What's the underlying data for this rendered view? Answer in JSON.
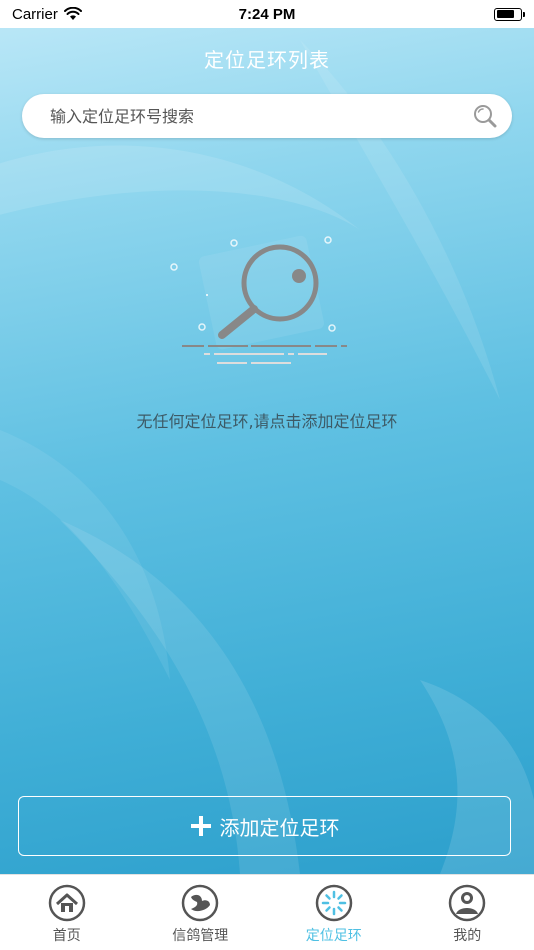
{
  "status_bar": {
    "carrier": "Carrier",
    "time": "7:24 PM"
  },
  "header": {
    "title": "定位足环列表"
  },
  "search": {
    "placeholder": "输入定位足环号搜索",
    "value": ""
  },
  "empty_state": {
    "message": "无任何定位足环,请点击添加定位足环",
    "icon": "magnifier-empty-icon"
  },
  "actions": {
    "add_label": "添加定位足环"
  },
  "tabs": [
    {
      "label": "首页",
      "icon": "home-icon",
      "active": false
    },
    {
      "label": "信鸽管理",
      "icon": "pigeon-icon",
      "active": false
    },
    {
      "label": "定位足环",
      "icon": "locator-icon",
      "active": true
    },
    {
      "label": "我的",
      "icon": "user-icon",
      "active": false
    }
  ],
  "colors": {
    "accent": "#4fc0e3",
    "tab_inactive": "#555555",
    "background_top": "#bfe9f8",
    "background_bottom": "#2c9fcc"
  }
}
